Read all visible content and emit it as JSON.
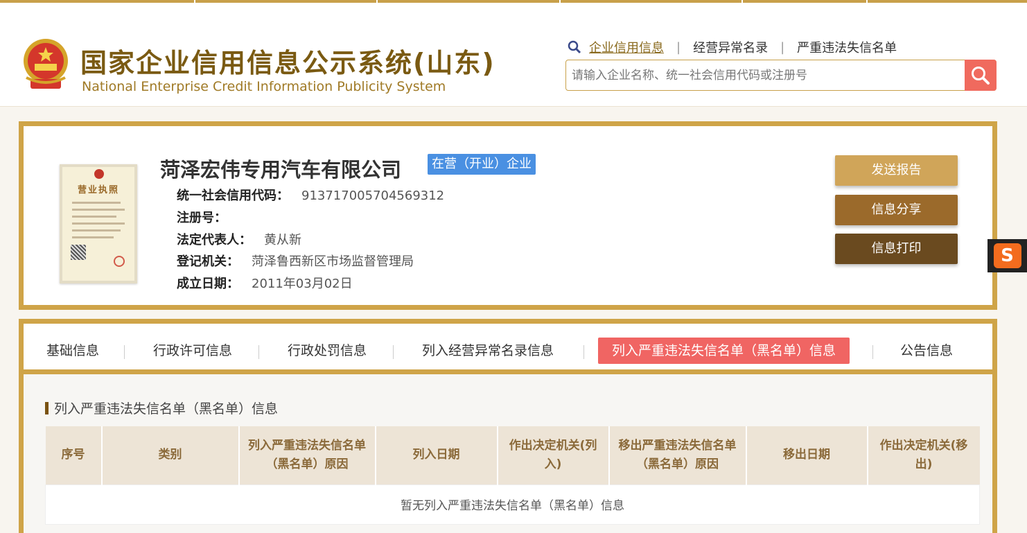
{
  "header": {
    "title": "国家企业信用信息公示系统(山东)",
    "subtitle": "National Enterprise Credit Information Publicity System",
    "nav_links": [
      "企业信用信息",
      "经营异常名录",
      "严重违法失信名单"
    ],
    "search_placeholder": "请输入企业名称、统一社会信用代码或注册号"
  },
  "company": {
    "name": "菏泽宏伟专用汽车有限公司",
    "status": "在营（开业）企业",
    "license_title": "营业执照",
    "fields": [
      {
        "label": "统一社会信用代码：",
        "value": "913717005704569312"
      },
      {
        "label": "注册号：",
        "value": ""
      },
      {
        "label": "法定代表人：",
        "value": "黄从新"
      },
      {
        "label": "登记机关：",
        "value": "菏泽鲁西新区市场监督管理局"
      },
      {
        "label": "成立日期：",
        "value": "2011年03月02日"
      }
    ],
    "actions": [
      "发送报告",
      "信息分享",
      "信息打印"
    ]
  },
  "tabs": [
    {
      "label": "基础信息",
      "active": false
    },
    {
      "label": "行政许可信息",
      "active": false
    },
    {
      "label": "行政处罚信息",
      "active": false
    },
    {
      "label": "列入经营异常名录信息",
      "active": false
    },
    {
      "label": "列入严重违法失信名单（黑名单）信息",
      "active": true
    },
    {
      "label": "公告信息",
      "active": false
    }
  ],
  "section": {
    "title": "列入严重违法失信名单（黑名单）信息",
    "columns": [
      "序号",
      "类别",
      "列入严重违法失信名单（黑名单）原因",
      "列入日期",
      "作出决定机关(列入)",
      "移出严重违法失信名单（黑名单）原因",
      "移出日期",
      "作出决定机关(移出)"
    ],
    "empty_text": "暂无列入严重违法失信名单（黑名单）信息"
  },
  "colors": {
    "brand_gold": "#cfa448",
    "active_tab": "#f06563",
    "status_badge": "#4a90e2",
    "btn_report": "#d0a559",
    "btn_share": "#9b6a2b",
    "btn_print": "#6a4a1f"
  },
  "icons": [
    "national-emblem-icon",
    "search-icon",
    "sogou-icon"
  ]
}
